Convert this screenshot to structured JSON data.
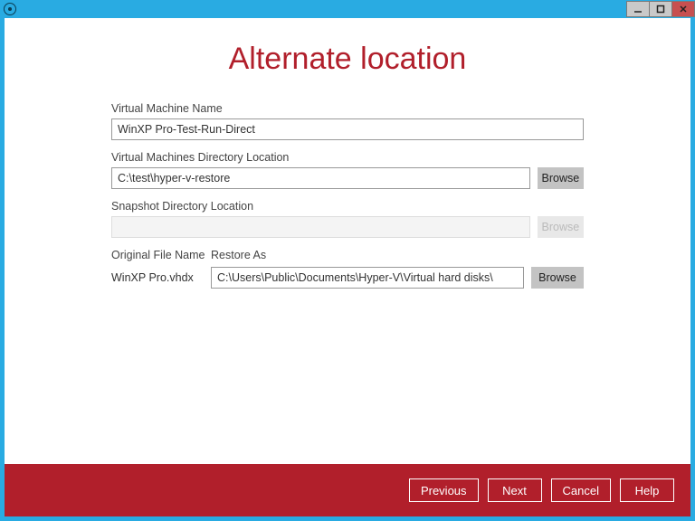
{
  "title": "Alternate location",
  "fields": {
    "vm_name_label": "Virtual Machine Name",
    "vm_name_value": "WinXP Pro-Test-Run-Direct",
    "vm_dir_label": "Virtual Machines Directory Location",
    "vm_dir_value": "C:\\test\\hyper-v-restore",
    "snapshot_label": "Snapshot Directory Location",
    "snapshot_value": "",
    "browse_label": "Browse"
  },
  "columns": {
    "original": "Original File Name",
    "restore_as": "Restore As"
  },
  "files": [
    {
      "original": "WinXP Pro.vhdx",
      "restore_as": "C:\\Users\\Public\\Documents\\Hyper-V\\Virtual hard disks\\"
    }
  ],
  "footer": {
    "previous": "Previous",
    "next": "Next",
    "cancel": "Cancel",
    "help": "Help"
  }
}
